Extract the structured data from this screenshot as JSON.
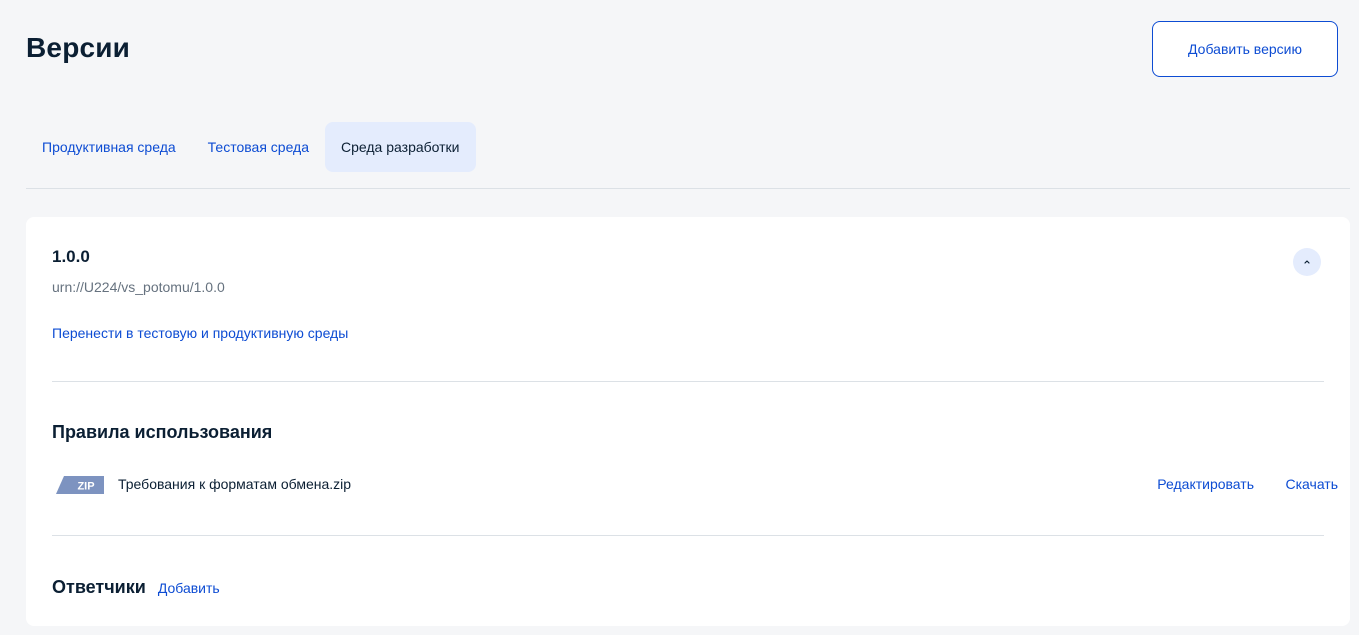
{
  "header": {
    "title": "Версии",
    "add_version_label": "Добавить версию"
  },
  "tabs": [
    {
      "label": "Продуктивная среда",
      "active": false
    },
    {
      "label": "Тестовая среда",
      "active": false
    },
    {
      "label": "Среда разработки",
      "active": true
    }
  ],
  "version": {
    "number": "1.0.0",
    "urn": "urn://U224/vs_potomu/1.0.0",
    "move_link": "Перенести в тестовую и продуктивную среды",
    "collapse_icon": "chevron-up-icon"
  },
  "rules": {
    "title": "Правила использования",
    "file": {
      "icon": "zip-file-icon",
      "icon_text": "ZIP",
      "name": "Требования к форматам обмена.zip",
      "edit_label": "Редактировать",
      "download_label": "Скачать"
    }
  },
  "responders": {
    "title": "Ответчики",
    "add_label": "Добавить"
  },
  "colors": {
    "accent": "#0d4cd3",
    "active_tab_bg": "#e4ecfd",
    "text": "#0b1f33",
    "muted": "#66727f",
    "zip_badge": "#7d93c0"
  }
}
